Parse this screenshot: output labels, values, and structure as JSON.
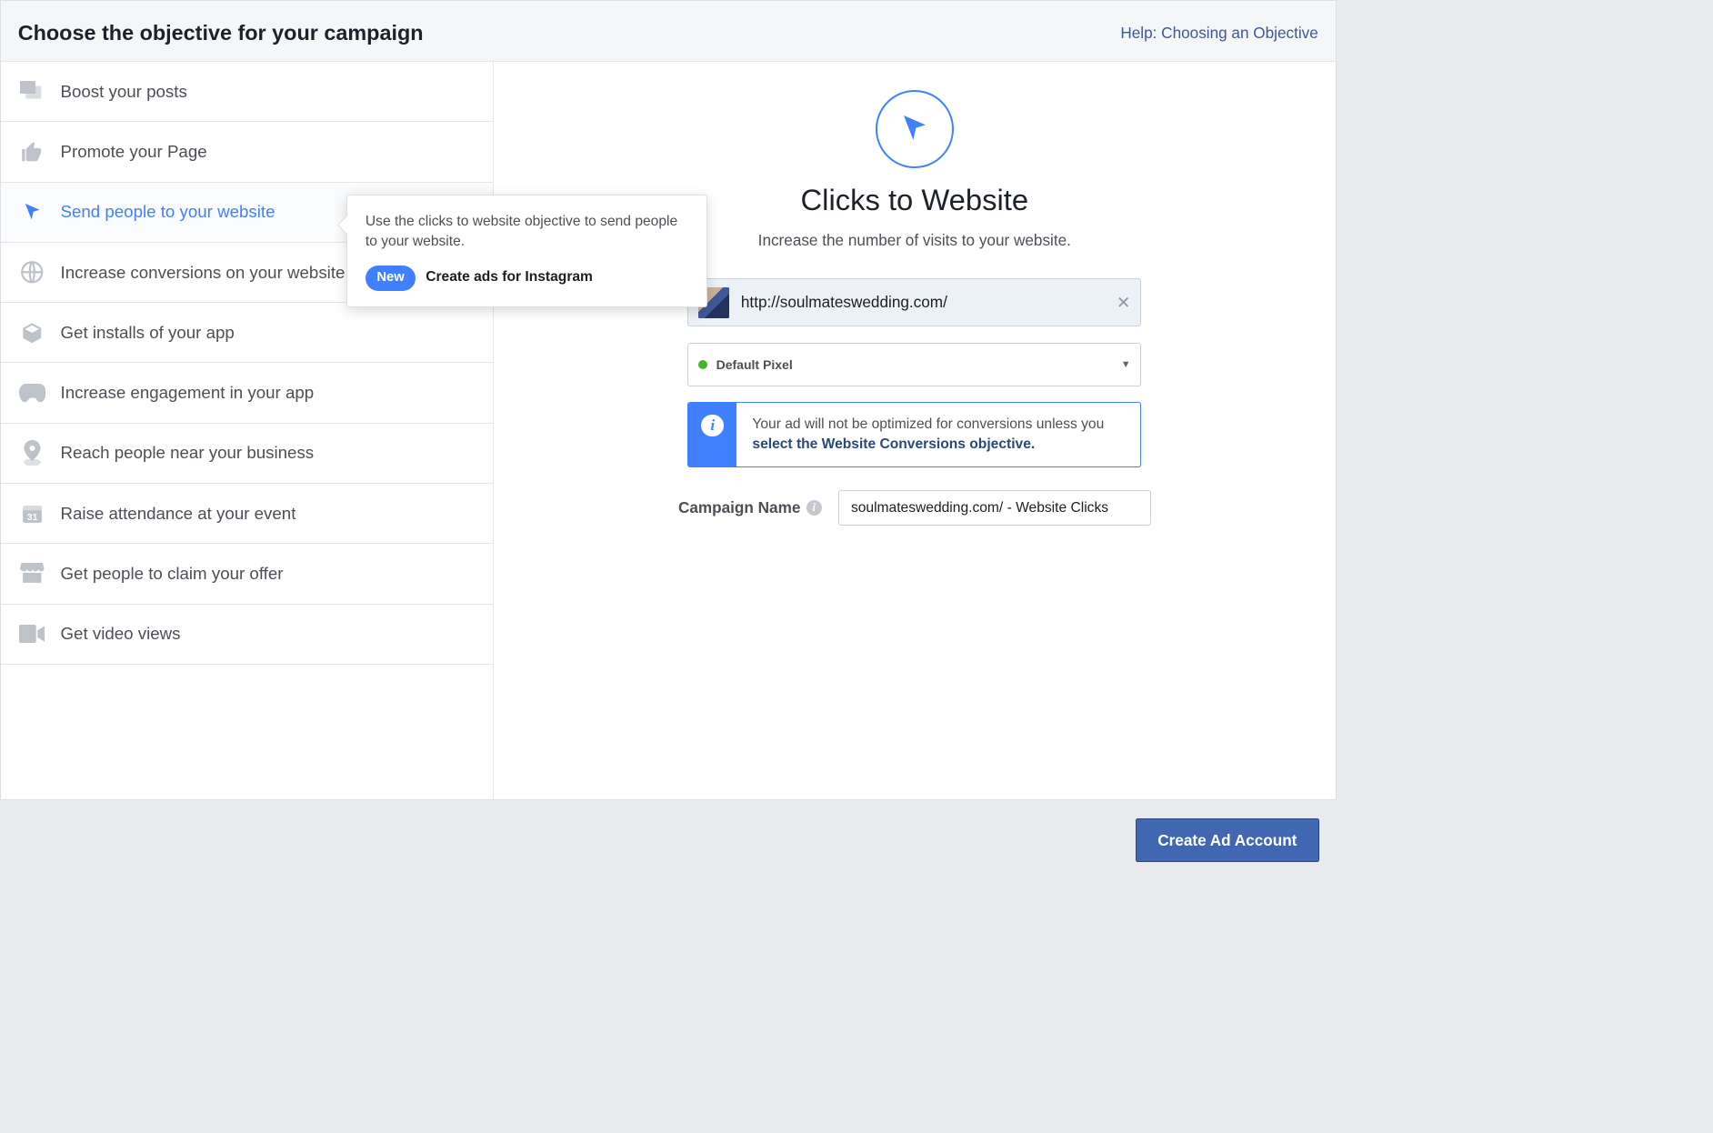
{
  "header": {
    "title": "Choose the objective for your campaign",
    "help_link": "Help: Choosing an Objective"
  },
  "objectives": [
    {
      "label": "Boost your posts"
    },
    {
      "label": "Promote your Page"
    },
    {
      "label": "Send people to your website"
    },
    {
      "label": "Increase conversions on your website"
    },
    {
      "label": "Get installs of your app"
    },
    {
      "label": "Increase engagement in your app"
    },
    {
      "label": "Reach people near your business"
    },
    {
      "label": "Raise attendance at your event"
    },
    {
      "label": "Get people to claim your offer"
    },
    {
      "label": "Get video views"
    }
  ],
  "selected_index": 2,
  "tooltip": {
    "text": "Use the clicks to website objective to send people to your website.",
    "pill": "New",
    "extra": "Create ads for Instagram"
  },
  "details": {
    "title": "Clicks to Website",
    "subtitle": "Increase the number of visits to your website.",
    "url": "http://soulmateswedding.com/",
    "pixel": "Default Pixel",
    "info_prefix": "Your ad will not be optimized for conversions unless you ",
    "info_link": "select the Website Conversions objective.",
    "campaign_label": "Campaign Name",
    "campaign_value": "soulmateswedding.com/ - Website Clicks"
  },
  "footer": {
    "cta": "Create Ad Account"
  }
}
